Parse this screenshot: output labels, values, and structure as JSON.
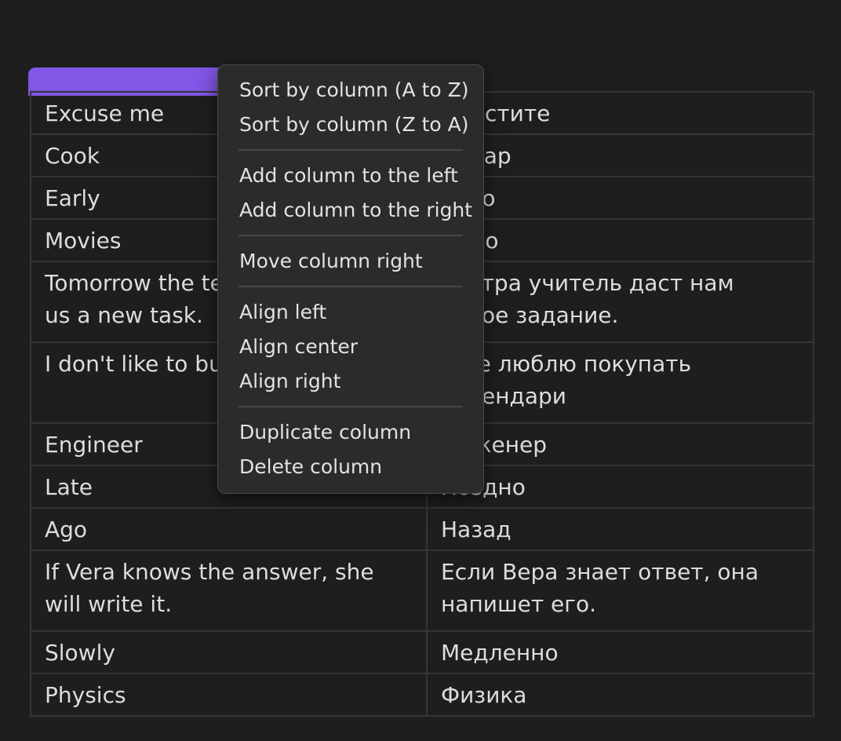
{
  "table": {
    "rows": [
      {
        "en": "Excuse me",
        "ru": "Простите"
      },
      {
        "en": "Cook",
        "ru": "Повар"
      },
      {
        "en": "Early",
        "ru": "Рано"
      },
      {
        "en": "Movies",
        "ru": "Кино"
      },
      {
        "en": "Tomorrow the teacher will give us a new task.",
        "ru": "Завтра учитель даст нам новое задание."
      },
      {
        "en": "I don't like to buy calendars",
        "ru": "Я не люблю покупать календари"
      },
      {
        "en": "Engineer",
        "ru": "Инженер"
      },
      {
        "en": "Late",
        "ru": "Поздно"
      },
      {
        "en": "Ago",
        "ru": "Назад"
      },
      {
        "en": "If Vera knows the answer, she will write it.",
        "ru": "Если Вера знает ответ, она напишет его."
      },
      {
        "en": "Slowly",
        "ru": "Медленно"
      },
      {
        "en": "Physics",
        "ru": "Физика"
      }
    ]
  },
  "context_menu": {
    "sort_az": "Sort by column (A to Z)",
    "sort_za": "Sort by column (Z to A)",
    "add_left": "Add column to the left",
    "add_right": "Add column to the right",
    "move_right": "Move column right",
    "align_left": "Align left",
    "align_center": "Align center",
    "align_right": "Align right",
    "duplicate": "Duplicate column",
    "delete": "Delete column"
  },
  "colors": {
    "background": "#1e1e1e",
    "accent": "#8256e6",
    "menu_bg": "#2b2b2b",
    "border": "#363636",
    "text": "#dcddde"
  }
}
